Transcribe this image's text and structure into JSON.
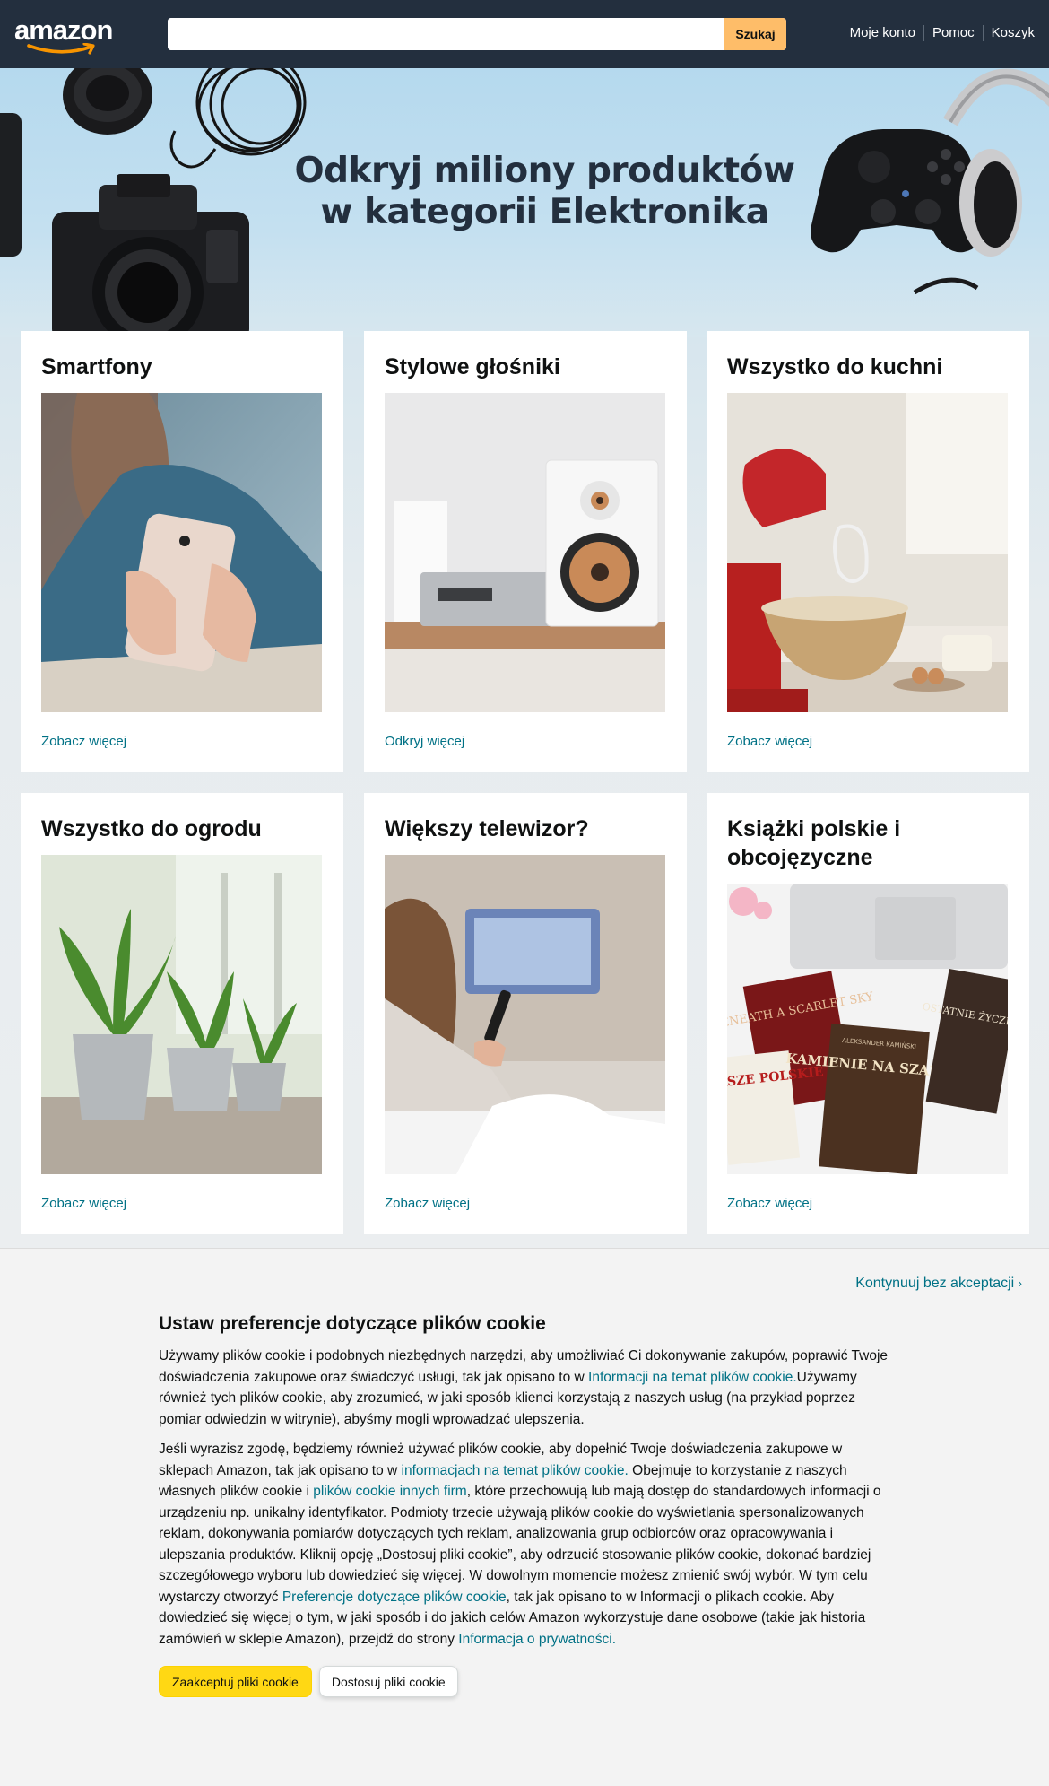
{
  "header": {
    "logo_text": "amazon",
    "search": {
      "value": "",
      "placeholder": ""
    },
    "search_button": "Szukaj",
    "nav": [
      "Moje konto",
      "Pomoc",
      "Koszyk"
    ]
  },
  "hero": {
    "title_line1": "Odkryj miliony produktów",
    "title_line2": "w kategorii Elektronika"
  },
  "cards": [
    {
      "title": "Smartfony",
      "link": "Zobacz więcej"
    },
    {
      "title": "Stylowe głośniki",
      "link": "Odkryj więcej"
    },
    {
      "title": "Wszystko do kuchni",
      "link": "Zobacz więcej"
    },
    {
      "title": "Wszystko do ogrodu",
      "link": "Zobacz więcej"
    },
    {
      "title": "Większy telewizor?",
      "link": "Zobacz więcej"
    },
    {
      "title": "Książki polskie i obcojęzyczne",
      "link": "Zobacz więcej"
    }
  ],
  "book_covers": [
    "BENEATH A SCARLET SKY",
    "WIERSZE POLSKIE",
    "KAMIENIE NA SZANIEC",
    "OSTATNIE ŻYCZENIE",
    "ALEKSANDER KAMIŃSKI"
  ],
  "cookie": {
    "skip": "Kontynuuj bez akceptacji",
    "title": "Ustaw preferencje dotyczące plików cookie",
    "p1_a": "Używamy plików cookie i podobnych niezbędnych narzędzi, aby umożliwiać Ci dokonywanie zakupów, poprawić Twoje doświadczenia zakupowe oraz świadczyć usługi, tak jak opisano to w ",
    "p1_link": "Informacji na temat plików cookie.",
    "p1_b": "Używamy również tych plików cookie, aby zrozumieć, w jaki sposób klienci korzystają z naszych usług (na przykład poprzez pomiar odwiedzin w witrynie), abyśmy mogli wprowadzać ulepszenia.",
    "p2_a": "Jeśli wyrazisz zgodę, będziemy również używać plików cookie, aby dopełnić Twoje doświadczenia zakupowe w sklepach Amazon, tak jak opisano to w ",
    "p2_link1": "informacjach na temat plików cookie.",
    "p2_b": " Obejmuje to korzystanie z naszych własnych plików cookie i ",
    "p2_link2": "plików cookie innych firm",
    "p2_c": ", które przechowują lub mają dostęp do standardowych informacji o urządzeniu np. unikalny identyfikator. Podmioty trzecie używają plików cookie do wyświetlania spersonalizowanych reklam, dokonywania pomiarów dotyczących tych reklam, analizowania grup odbiorców oraz opracowywania i ulepszania produktów. Kliknij opcję „Dostosuj pliki cookie”, aby odrzucić stosowanie plików cookie, dokonać bardziej szczegółowego wyboru lub dowiedzieć się więcej. W dowolnym momencie możesz zmienić swój wybór. W tym celu wystarczy otworzyć ",
    "p2_link3": "Preferencje dotyczące plików cookie",
    "p2_d": ", tak jak opisano to w Informacji o plikach cookie. Aby dowiedzieć się więcej o tym, w jaki sposób i do jakich celów Amazon wykorzystuje dane osobowe (takie jak historia zamówień w sklepie Amazon), przejdź do strony ",
    "p2_link4": "Informacja o prywatności.",
    "accept": "Zaakceptuj pliki cookie",
    "customize": "Dostosuj pliki cookie"
  },
  "colors": {
    "header_bg": "#232f3e",
    "search_button": "#febd69",
    "link": "#007185",
    "accept_button": "#ffd814"
  }
}
